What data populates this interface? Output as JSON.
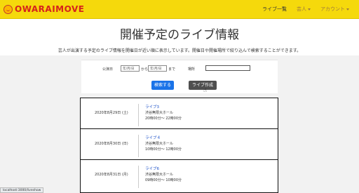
{
  "navbar": {
    "brand": "OWARAIMOVE",
    "links": [
      {
        "label": "ライブ一覧",
        "caret": false
      },
      {
        "label": "芸人",
        "caret": true
      },
      {
        "label": "アカウント",
        "caret": true
      }
    ]
  },
  "header": {
    "title": "開催予定のライブ情報",
    "subtitle": "芸人が出演する予定のライブ情報を開催日が近い順に表示しています。開催日や開催場所で絞り込んで検索することができます。"
  },
  "search": {
    "date_label": "公演日",
    "from_placeholder": "年/月/日",
    "from_sep": "から",
    "to_placeholder": "年/月/日",
    "to_sep": "まで",
    "place_label": "場所",
    "place_value": "",
    "search_button": "検索する",
    "create_button": "ライブ作成"
  },
  "lives": [
    {
      "date": "2020年8月29日 (土)",
      "title": "ライブ3",
      "venue": "渋谷無限大ホール",
      "time": "20時00分〜 22時00分"
    },
    {
      "date": "2020年8月30日 (日)",
      "title": "ライブ４",
      "venue": "渋谷無限大ホール",
      "time": "10時00分〜 12時00分"
    },
    {
      "date": "2020年8月31日 (月)",
      "title": "ライブ6",
      "venue": "渋谷無限大ホール",
      "time": "09時00分〜 10時00分"
    }
  ],
  "status_url": "localhost:3000/liveshow"
}
